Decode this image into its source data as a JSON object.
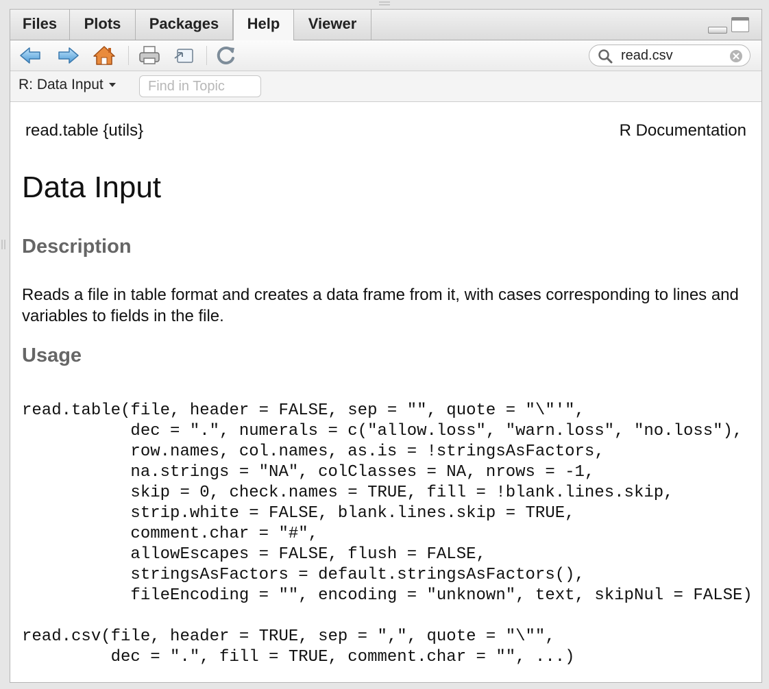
{
  "tabs": [
    {
      "label": "Files"
    },
    {
      "label": "Plots"
    },
    {
      "label": "Packages"
    },
    {
      "label": "Help",
      "active": true
    },
    {
      "label": "Viewer"
    }
  ],
  "toolbar": {
    "icons": [
      "back-arrow-icon",
      "forward-arrow-icon",
      "home-icon",
      "print-icon",
      "open-external-icon",
      "refresh-icon"
    ],
    "search_value": "read.csv"
  },
  "subbar": {
    "topic_label": "R: Data Input",
    "find_placeholder": "Find in Topic"
  },
  "doc": {
    "header_left": "read.table {utils}",
    "header_right": "R Documentation",
    "title": "Data Input",
    "description_heading": "Description",
    "description_text": "Reads a file in table format and creates a data frame from it, with cases corresponding to lines and variables to fields in the file.",
    "usage_heading": "Usage",
    "usage_code_1": "read.table(file, header = FALSE, sep = \"\", quote = \"\\\"'\",\n           dec = \".\", numerals = c(\"allow.loss\", \"warn.loss\", \"no.loss\"),\n           row.names, col.names, as.is = !stringsAsFactors,\n           na.strings = \"NA\", colClasses = NA, nrows = -1,\n           skip = 0, check.names = TRUE, fill = !blank.lines.skip,\n           strip.white = FALSE, blank.lines.skip = TRUE,\n           comment.char = \"#\",\n           allowEscapes = FALSE, flush = FALSE,\n           stringsAsFactors = default.stringsAsFactors(),\n           fileEncoding = \"\", encoding = \"unknown\", text, skipNul = FALSE)",
    "usage_code_2": "read.csv(file, header = TRUE, sep = \",\", quote = \"\\\"\",\n         dec = \".\", fill = TRUE, comment.char = \"\", ...)"
  }
}
